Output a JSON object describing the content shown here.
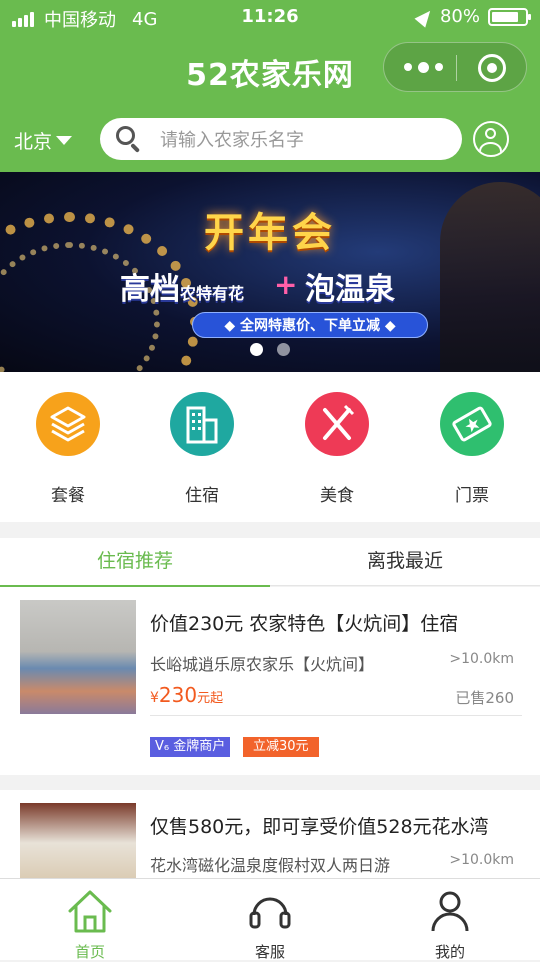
{
  "status": {
    "carrier": "中国移动",
    "network": "4G",
    "time": "11:26",
    "battery": "80%"
  },
  "app": {
    "title": "52农家乐网"
  },
  "location": {
    "city": "北京"
  },
  "search": {
    "placeholder": "请输入农家乐名字"
  },
  "banner": {
    "headline": "开年会",
    "line_left": "高档",
    "line_left_small": "农特有花",
    "plus": "+",
    "line_right": "泡温泉",
    "pill": "◆ 全网特惠价、下单立减 ◆",
    "active_index": 0,
    "dot_count": 2
  },
  "categories": [
    {
      "label": "套餐",
      "icon": "layers-icon",
      "color": "#f7a21b"
    },
    {
      "label": "住宿",
      "icon": "building-icon",
      "color": "#1fa8a0"
    },
    {
      "label": "美食",
      "icon": "fork-knife-icon",
      "color": "#ee3a56"
    },
    {
      "label": "门票",
      "icon": "ticket-icon",
      "color": "#2fbf6f"
    }
  ],
  "tabs": [
    {
      "label": "住宿推荐",
      "active": true
    },
    {
      "label": "离我最近",
      "active": false
    }
  ],
  "listings": [
    {
      "title": "价值230元 农家特色【火炕间】住宿",
      "sub": "长峪城逍乐原农家乐【火炕间】",
      "distance": ">10.0km",
      "currency": "¥",
      "price": "230",
      "price_suffix": "元起",
      "sold": "已售260",
      "badges": [
        "V₆ 金牌商户",
        "立减30元"
      ]
    },
    {
      "title": "仅售580元，即可享受价值528元花水湾",
      "sub": "花水湾磁化温泉度假村双人两日游",
      "distance": ">10.0km"
    }
  ],
  "bottom_nav": [
    {
      "label": "首页",
      "icon": "home-icon",
      "active": true
    },
    {
      "label": "客服",
      "icon": "headset-icon",
      "active": false
    },
    {
      "label": "我的",
      "icon": "user-icon",
      "active": false
    }
  ],
  "colors": {
    "brand": "#6abb4f",
    "price": "#f25a1f"
  }
}
